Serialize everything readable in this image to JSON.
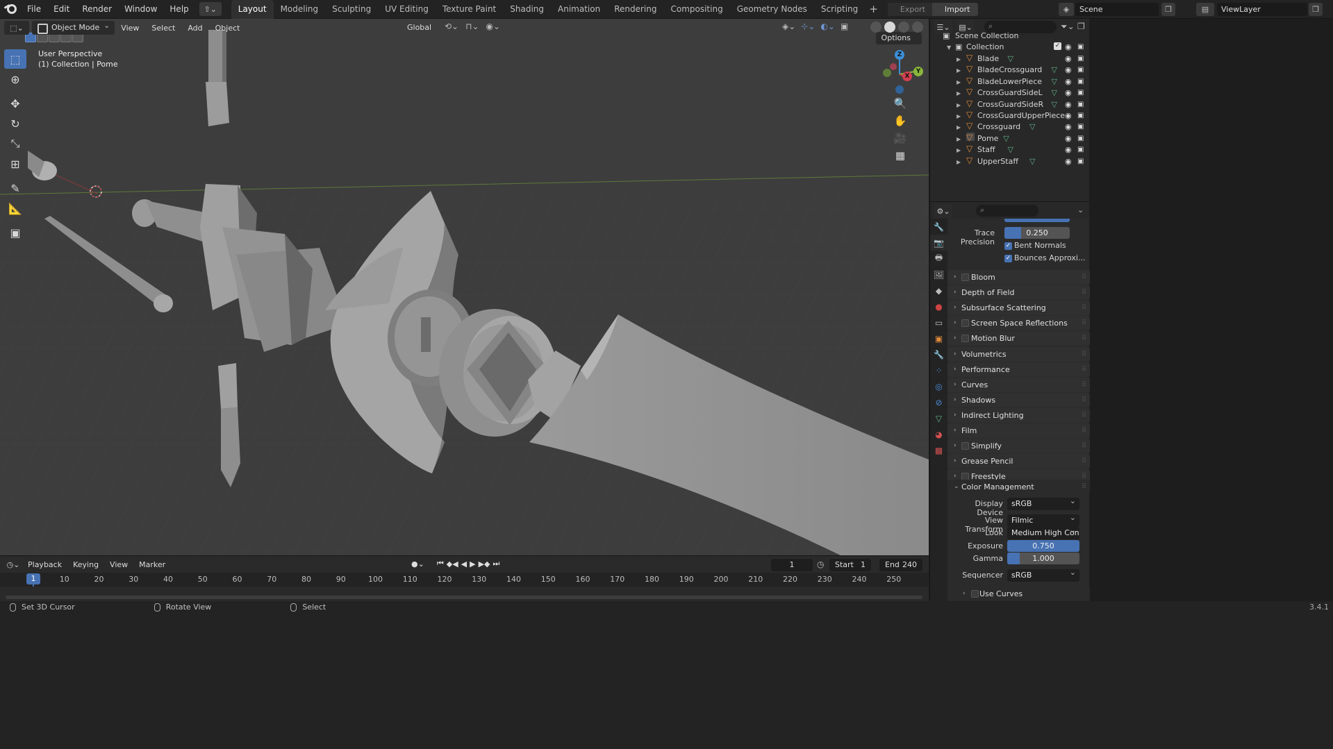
{
  "app": {
    "menus": [
      "File",
      "Edit",
      "Render",
      "Window",
      "Help"
    ],
    "workspaces": [
      "Layout",
      "Modeling",
      "Sculpting",
      "UV Editing",
      "Texture Paint",
      "Shading",
      "Animation",
      "Rendering",
      "Compositing",
      "Geometry Nodes",
      "Scripting"
    ],
    "active_workspace": "Layout",
    "export_label": "Export",
    "import_label": "Import",
    "scene": "Scene",
    "view_layer": "ViewLayer"
  },
  "viewport": {
    "mode": "Object Mode",
    "menus": [
      "View",
      "Select",
      "Add",
      "Object"
    ],
    "orientation": "Global",
    "options_label": "Options",
    "info_line1": "User Perspective",
    "info_line2": "(1) Collection | Pome",
    "axes": {
      "x": "X",
      "y": "Y",
      "z": "Z"
    }
  },
  "timeline": {
    "menus": [
      "Playback",
      "Keying",
      "View",
      "Marker"
    ],
    "current_frame": "1",
    "start_label": "Start",
    "start": "1",
    "end_label": "End",
    "end": "240",
    "ticks": [
      "10",
      "20",
      "30",
      "40",
      "50",
      "60",
      "70",
      "80",
      "90",
      "100",
      "110",
      "120",
      "130",
      "140",
      "150",
      "160",
      "170",
      "180",
      "190",
      "200",
      "210",
      "220",
      "230",
      "240",
      "250"
    ]
  },
  "statusbar": {
    "items": [
      "Set 3D Cursor",
      "Rotate View",
      "Select"
    ],
    "version": "3.4.1"
  },
  "outliner": {
    "root": "Scene Collection",
    "collection": "Collection",
    "objects": [
      "Blade",
      "BladeCrossguard",
      "BladeLowerPiece",
      "CrossGuardSideL",
      "CrossGuardSideR",
      "CrossGuardUpperPiece",
      "Crossguard",
      "Pome",
      "Staff",
      "UpperStaff"
    ],
    "active_object": "Pome"
  },
  "properties": {
    "trace_precision_label": "Trace Precision",
    "trace_precision": "0.250",
    "trace_precision_fraction": 0.25,
    "bent_normals": "Bent Normals",
    "bounces_approx": "Bounces Approxi...",
    "panels": [
      {
        "title": "Bloom",
        "checkbox": true
      },
      {
        "title": "Depth of Field",
        "checkbox": false
      },
      {
        "title": "Subsurface Scattering",
        "checkbox": false
      },
      {
        "title": "Screen Space Reflections",
        "checkbox": true
      },
      {
        "title": "Motion Blur",
        "checkbox": true
      },
      {
        "title": "Volumetrics",
        "checkbox": false
      },
      {
        "title": "Performance",
        "checkbox": false
      },
      {
        "title": "Curves",
        "checkbox": false
      },
      {
        "title": "Shadows",
        "checkbox": false
      },
      {
        "title": "Indirect Lighting",
        "checkbox": false
      },
      {
        "title": "Film",
        "checkbox": false
      },
      {
        "title": "Simplify",
        "checkbox": true
      },
      {
        "title": "Grease Pencil",
        "checkbox": false
      },
      {
        "title": "Freestyle",
        "checkbox": true
      }
    ],
    "color_management": {
      "title": "Color Management",
      "display_device_label": "Display Device",
      "display_device": "sRGB",
      "view_transform_label": "View Transform",
      "view_transform": "Filmic",
      "look_label": "Look",
      "look": "Medium High Contr...",
      "exposure_label": "Exposure",
      "exposure": "0.750",
      "gamma_label": "Gamma",
      "gamma": "1.000",
      "sequencer_label": "Sequencer",
      "sequencer": "sRGB",
      "use_curves": "Use Curves"
    }
  },
  "colors": {
    "accent": "#4772b3",
    "viewport_bg": "#3d3d3d",
    "mesh": "#8c8c8c",
    "object_icon": "#e08b3a",
    "mesh_data_icon": "#5fb58a"
  }
}
